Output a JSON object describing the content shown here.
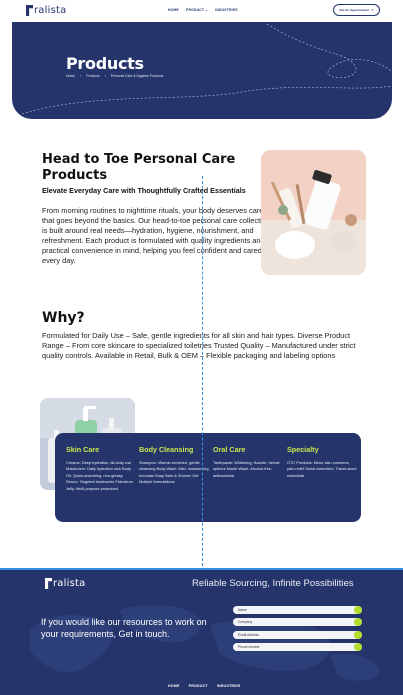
{
  "header": {
    "logo_text": "ralista",
    "nav": [
      "HOME",
      "PRODUCT",
      "INDUSTRIES"
    ],
    "appointment_label": "Get An Appointment",
    "appointment_arrow": "↗"
  },
  "hero": {
    "title": "Products",
    "breadcrumb": [
      "Home",
      "›",
      "Products",
      "›",
      "Personal Care & Hygiene Products"
    ]
  },
  "intro": {
    "title": "Head to Toe Personal Care Products",
    "subtitle": "Elevate Everyday Care with Thoughtfully Crafted Essentials",
    "body": "From morning routines to nighttime rituals, your body deserves care that goes beyond the basics. Our head-to-toe personal care collection is built around real needs—hydration, hygiene, nourishment, and refreshment. Each product is formulated with quality ingredients and practical convenience in mind, helping you feel confident and cared for, every day."
  },
  "why": {
    "title": "Why?",
    "body": "Formulated for Daily Use – Safe, gentle ingredients for all skin and hair types. Diverse Product Range – From core skincare to specialized toiletries Trusted Quality – Manufactured under strict quality controls. Available in Retail, Bulk & OEM – Flexible packaging and labeling options"
  },
  "categories": [
    {
      "title": "Skin Care",
      "text": "Creams: Deep hydration, all-body use Moisturizer: Daily hydration lock Body Oil: Quick-absorbing, non-greasy Serum: Targeted treatments Petroleum Jelly: Multi-purpose protectant"
    },
    {
      "title": "Body Cleansing",
      "text": "Shampoo: Vitamin-enriched, gentle cleansing Body Wash: Mild, moisturizing formulas Soap Bars & Shower Gel: Multiple formulations"
    },
    {
      "title": "Oral Care",
      "text": "Toothpaste: Whitening, fluoride, herbal options Mouth Wash: Alcohol-free, antibacterial"
    },
    {
      "title": "Specialty",
      "text": "OTC Products: Minor skin concerns, pain relief Guest Amenities: Travel-sized essentials"
    }
  ],
  "footer": {
    "logo_text": "ralista",
    "tagline": "Reliable Sourcing, Infinite Possibilities",
    "cta": "If you would like our resources to work on your requirements, Get in touch.",
    "fields": [
      {
        "placeholder": "Name"
      },
      {
        "placeholder": "Company"
      },
      {
        "placeholder": "Email Address"
      },
      {
        "placeholder": "Phone number"
      }
    ],
    "nav": [
      "HOME",
      "PRODUCT",
      "INDUSTRIES"
    ]
  },
  "colors": {
    "navy": "#25356b",
    "accent_lime": "#c8e64b",
    "accent_blue": "#3a8fe0"
  }
}
